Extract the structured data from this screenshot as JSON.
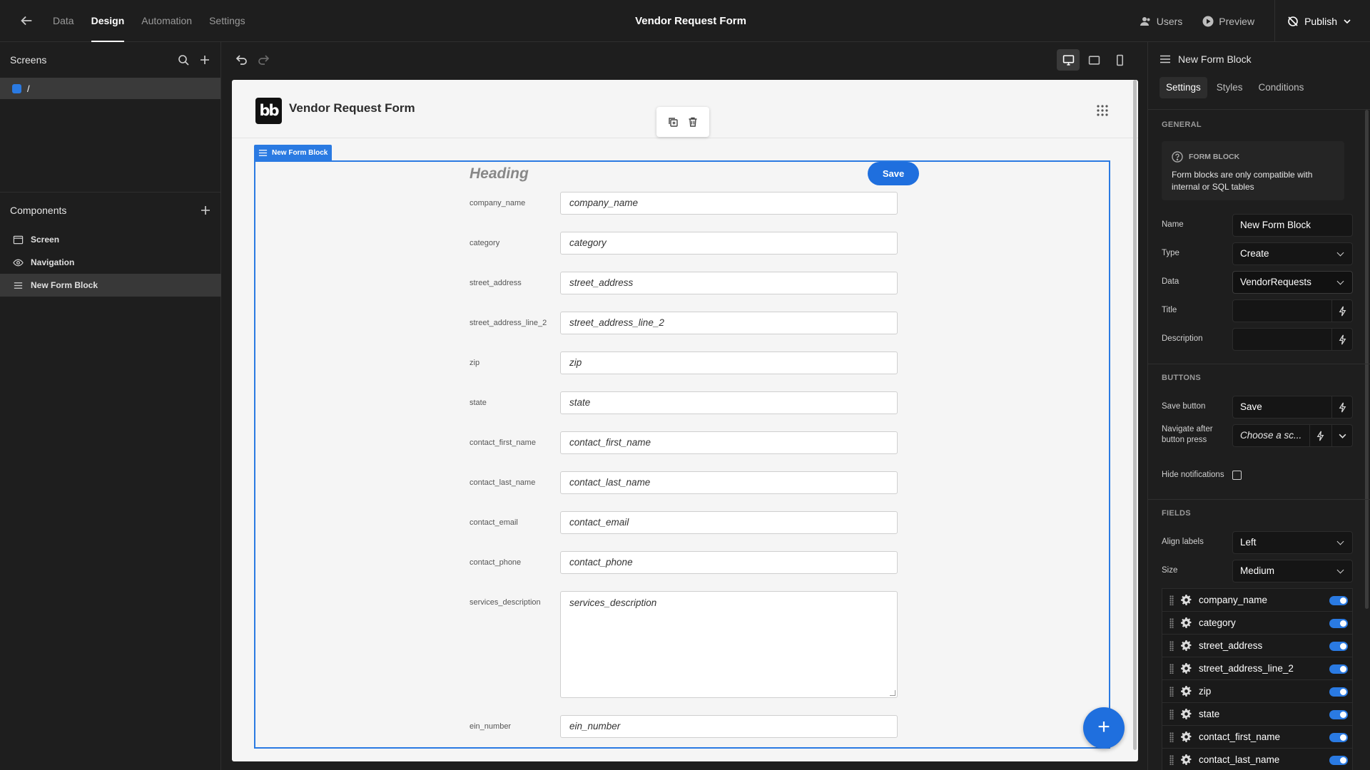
{
  "topbar": {
    "tabs": [
      "Data",
      "Design",
      "Automation",
      "Settings"
    ],
    "active_tab": "Design",
    "title": "Vendor Request Form",
    "users_label": "Users",
    "preview_label": "Preview",
    "publish_label": "Publish"
  },
  "left_panel": {
    "screens_title": "Screens",
    "screens": [
      "/"
    ],
    "components_title": "Components",
    "components": [
      {
        "label": "Screen",
        "icon": "screen-icon"
      },
      {
        "label": "Navigation",
        "icon": "eye-icon"
      },
      {
        "label": "New Form Block",
        "icon": "form-block-icon",
        "selected": true
      }
    ]
  },
  "preview": {
    "logo_text": "bb",
    "app_name": "Vendor Request Form",
    "block_tag": "New Form Block",
    "heading": "Heading",
    "save_label": "Save",
    "fields": [
      {
        "label": "company_name",
        "placeholder": "company_name"
      },
      {
        "label": "category",
        "placeholder": "category"
      },
      {
        "label": "street_address",
        "placeholder": "street_address"
      },
      {
        "label": "street_address_line_2",
        "placeholder": "street_address_line_2"
      },
      {
        "label": "zip",
        "placeholder": "zip"
      },
      {
        "label": "state",
        "placeholder": "state"
      },
      {
        "label": "contact_first_name",
        "placeholder": "contact_first_name"
      },
      {
        "label": "contact_last_name",
        "placeholder": "contact_last_name"
      },
      {
        "label": "contact_email",
        "placeholder": "contact_email"
      },
      {
        "label": "contact_phone",
        "placeholder": "contact_phone"
      },
      {
        "label": "services_description",
        "placeholder": "services_description"
      },
      {
        "label": "ein_number",
        "placeholder": "ein_number"
      }
    ],
    "fab_label": "+"
  },
  "right_panel": {
    "title": "New Form Block",
    "tabs": [
      "Settings",
      "Styles",
      "Conditions"
    ],
    "active_tab": "Settings",
    "general": {
      "section_title": "GENERAL",
      "info_title": "FORM BLOCK",
      "info_text": "Form blocks are only compatible with internal or SQL tables",
      "name_label": "Name",
      "name_value": "New Form Block",
      "type_label": "Type",
      "type_value": "Create",
      "data_label": "Data",
      "data_value": "VendorRequests",
      "title_label": "Title",
      "description_label": "Description"
    },
    "buttons": {
      "section_title": "BUTTONS",
      "save_label": "Save button",
      "save_value": "Save",
      "navigate_label": "Navigate after button press",
      "navigate_value": "Choose a sc...",
      "hide_label": "Hide notifications"
    },
    "fields": {
      "section_title": "FIELDS",
      "align_label": "Align labels",
      "align_value": "Left",
      "size_label": "Size",
      "size_value": "Medium",
      "items": [
        "company_name",
        "category",
        "street_address",
        "street_address_line_2",
        "zip",
        "state",
        "contact_first_name",
        "contact_last_name"
      ]
    }
  },
  "colors": {
    "accent": "#2a7ae2",
    "button": "#1f6fde",
    "background": "#1e1e1e",
    "canvas": "#f5f5f5"
  }
}
